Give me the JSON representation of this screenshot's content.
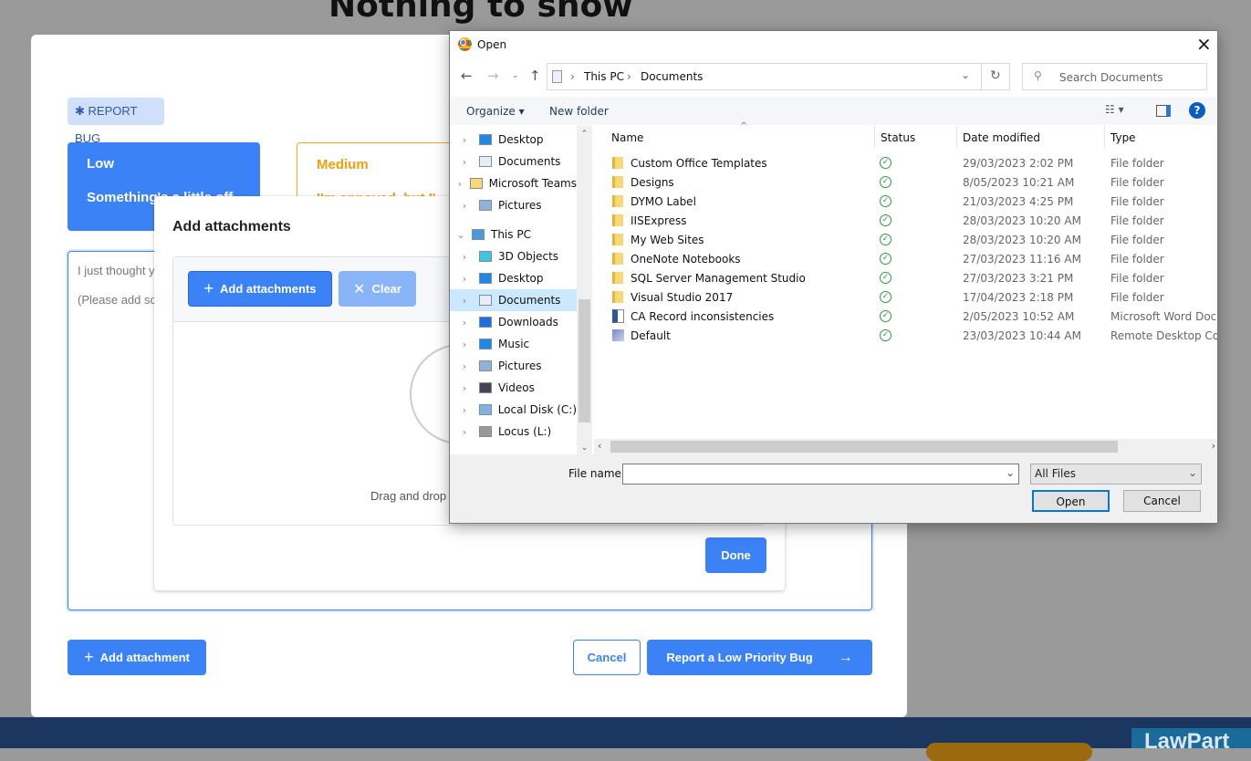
{
  "page": {
    "title": "Nothing to show"
  },
  "bug_form": {
    "badge": "REPORT BUG",
    "low": {
      "title": "Low",
      "desc": "Something's a little off"
    },
    "medium": {
      "title": "Medium",
      "desc": "I'm annoyed, but I'"
    },
    "textarea_lines": [
      "I just thought y",
      "(Please add scr"
    ],
    "add_attachment": "Add attachment",
    "cancel": "Cancel",
    "submit": "Report a Low Priority Bug",
    "accent": "#3b82f6",
    "medium_color": "#f5a623"
  },
  "attach_modal": {
    "title": "Add attachments",
    "add_button": "Add attachments",
    "clear_button": "Clear",
    "drop_text": "Drag and drop",
    "done": "Done"
  },
  "footer": {
    "logo_text": "LawPart"
  },
  "open_dialog": {
    "title": "Open",
    "close": "×",
    "breadcrumb": [
      "This PC",
      "Documents"
    ],
    "search_placeholder": "Search Documents",
    "organize": "Organize",
    "new_folder": "New folder",
    "nav": [
      {
        "label": "Desktop",
        "icon": "desktop-icon"
      },
      {
        "label": "Documents",
        "icon": "documents-icon"
      },
      {
        "label": "Microsoft Teams",
        "icon": "folder-icon"
      },
      {
        "label": "Pictures",
        "icon": "pictures-icon"
      },
      {
        "label": "This PC",
        "icon": "pc-icon"
      },
      {
        "label": "3D Objects",
        "icon": "3d-objects-icon"
      },
      {
        "label": "Desktop",
        "icon": "desktop-icon"
      },
      {
        "label": "Documents",
        "icon": "documents-icon",
        "selected": true
      },
      {
        "label": "Downloads",
        "icon": "downloads-icon"
      },
      {
        "label": "Music",
        "icon": "music-icon"
      },
      {
        "label": "Pictures",
        "icon": "pictures-icon"
      },
      {
        "label": "Videos",
        "icon": "videos-icon"
      },
      {
        "label": "Local Disk (C:)",
        "icon": "disk-icon"
      },
      {
        "label": "Locus (L:)",
        "icon": "network-drive-icon"
      }
    ],
    "columns": [
      "Name",
      "Status",
      "Date modified",
      "Type"
    ],
    "files": [
      {
        "name": "Custom Office Templates",
        "date": "29/03/2023 2:02 PM",
        "type": "File folder",
        "icon": "folder-icon"
      },
      {
        "name": "Designs",
        "date": "8/05/2023 10:21 AM",
        "type": "File folder",
        "icon": "folder-icon"
      },
      {
        "name": "DYMO Label",
        "date": "21/03/2023 4:25 PM",
        "type": "File folder",
        "icon": "folder-icon"
      },
      {
        "name": "IISExpress",
        "date": "28/03/2023 10:20 AM",
        "type": "File folder",
        "icon": "folder-icon"
      },
      {
        "name": "My Web Sites",
        "date": "28/03/2023 10:20 AM",
        "type": "File folder",
        "icon": "folder-icon"
      },
      {
        "name": "OneNote Notebooks",
        "date": "27/03/2023 11:16 AM",
        "type": "File folder",
        "icon": "folder-icon"
      },
      {
        "name": "SQL Server Management Studio",
        "date": "27/03/2023 3:21 PM",
        "type": "File folder",
        "icon": "folder-icon"
      },
      {
        "name": "Visual Studio 2017",
        "date": "17/04/2023 2:18 PM",
        "type": "File folder",
        "icon": "folder-icon"
      },
      {
        "name": "CA Record inconsistencies",
        "date": "2/05/2023 10:52 AM",
        "type": "Microsoft Word Doc...",
        "icon": "word-doc-icon"
      },
      {
        "name": "Default",
        "date": "23/03/2023 10:44 AM",
        "type": "Remote Desktop Con...",
        "icon": "rdp-icon"
      }
    ],
    "file_name_label": "File name:",
    "file_name_value": "",
    "filter": "All Files",
    "open": "Open",
    "cancel": "Cancel"
  }
}
